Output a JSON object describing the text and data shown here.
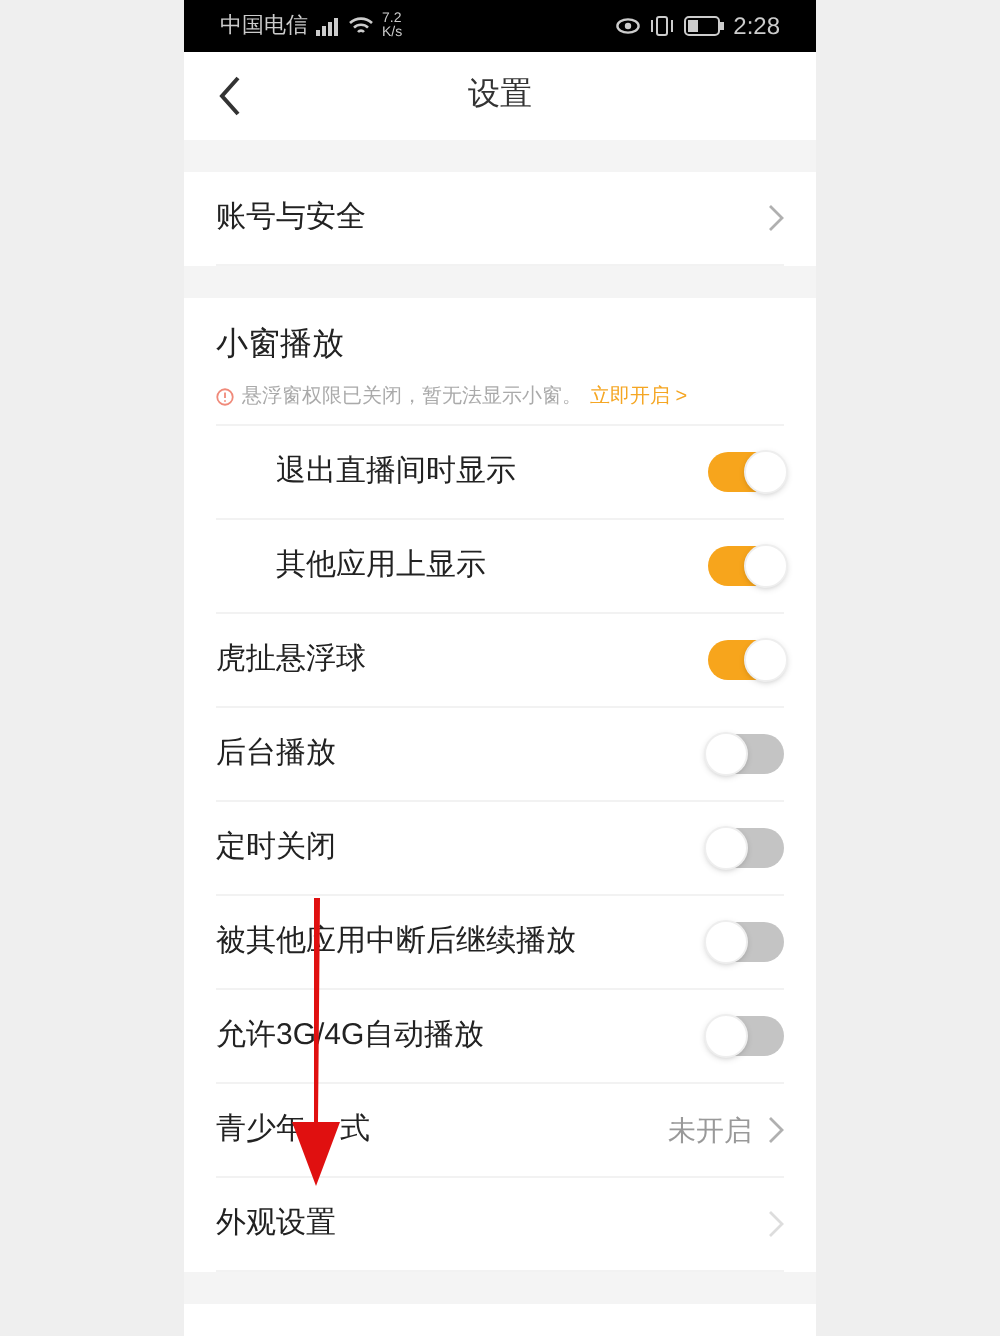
{
  "status_bar": {
    "carrier": "中国电信",
    "speed": "7.2",
    "speed_unit": "K/s",
    "time": "2:28"
  },
  "header": {
    "title": "设置"
  },
  "sections": [
    {
      "items": [
        {
          "kind": "link",
          "label": "账号与安全",
          "sub": false
        }
      ]
    },
    {
      "title": "小窗播放",
      "notice": {
        "text": "悬浮窗权限已关闭，暂无法显示小窗。",
        "action": "立即开启 >"
      },
      "items": [
        {
          "kind": "toggle",
          "label": "退出直播间时显示",
          "sub": true,
          "on": true
        },
        {
          "kind": "toggle",
          "label": "其他应用上显示",
          "sub": true,
          "on": true
        },
        {
          "kind": "toggle",
          "label": "虎扯悬浮球",
          "sub": false,
          "on": true
        },
        {
          "kind": "toggle",
          "label": "后台播放",
          "sub": false,
          "on": false
        },
        {
          "kind": "toggle",
          "label": "定时关闭",
          "sub": false,
          "on": false
        },
        {
          "kind": "toggle",
          "label": "被其他应用中断后继续播放",
          "sub": false,
          "on": false
        },
        {
          "kind": "toggle",
          "label": "允许3G/4G自动播放",
          "sub": false,
          "on": false
        },
        {
          "kind": "link",
          "label": "青少年",
          "label_after_arrow": "式",
          "sub": false,
          "value": "未开启"
        },
        {
          "kind": "link",
          "label": "外观设置",
          "sub": false
        }
      ]
    }
  ]
}
